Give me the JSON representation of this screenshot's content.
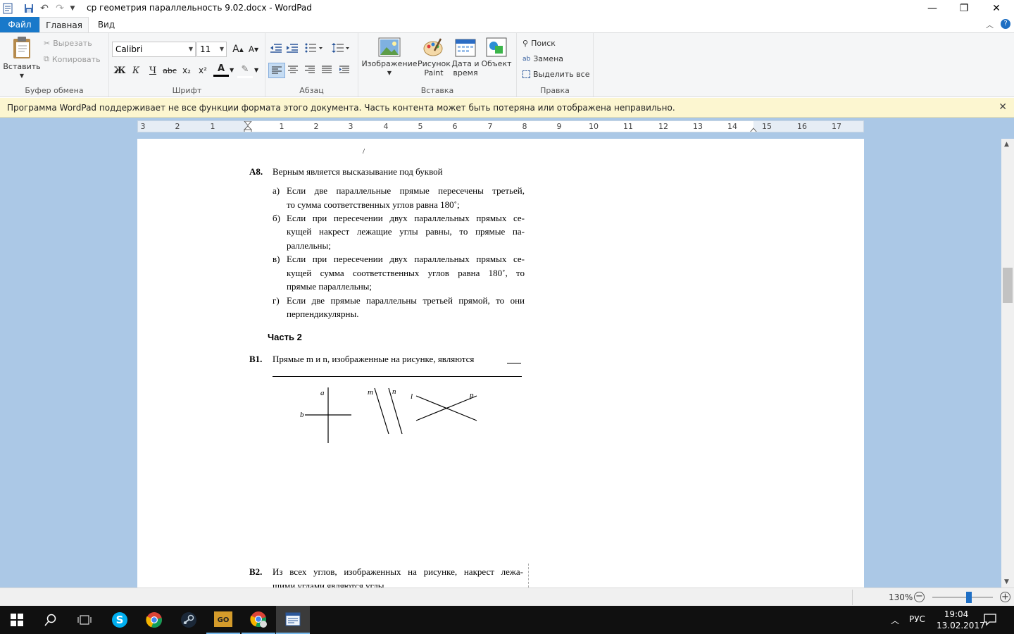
{
  "titlebar": {
    "title": "ср геометрия параллельность 9.02.docx - WordPad",
    "minimize": "—",
    "restore": "❐",
    "close": "✕"
  },
  "tabs": {
    "file": "Файл",
    "home": "Главная",
    "view": "Вид"
  },
  "ribbon": {
    "clipboard": {
      "label": "Буфер обмена",
      "paste": "Вставить",
      "cut": "Вырезать",
      "copy": "Копировать"
    },
    "font": {
      "label": "Шрифт",
      "family": "Calibri",
      "size": "11",
      "grow": "A",
      "shrink": "A",
      "bold": "Ж",
      "italic": "К",
      "underline": "Ч",
      "strike": "abc",
      "subscript": "x₂",
      "superscript": "x²",
      "color": "A",
      "highlight": "✎"
    },
    "paragraph": {
      "label": "Абзац"
    },
    "insert": {
      "label": "Вставка",
      "image": "Изображение",
      "paint_1": "Рисунок",
      "paint_2": "Paint",
      "datetime_1": "Дата и",
      "datetime_2": "время",
      "object": "Объект"
    },
    "edit": {
      "label": "Правка",
      "find": "Поиск",
      "replace": "Замена",
      "select_all": "Выделить все"
    }
  },
  "message": {
    "text": "Программа WordPad поддерживает не все функции формата этого документа. Часть контента может быть потеряна или отображена неправильно.",
    "close": "✕"
  },
  "ruler": {
    "left": [
      "3",
      "2",
      "1"
    ],
    "right": [
      "1",
      "2",
      "3",
      "4",
      "5",
      "6",
      "7",
      "8",
      "9",
      "10",
      "11",
      "12",
      "13",
      "14",
      "15",
      "16",
      "17"
    ]
  },
  "document": {
    "stray": "/",
    "a8": {
      "num": "А8.",
      "stem": "Верным является высказывание под буквой",
      "opt_a_mark": "а)",
      "opt_a_1": "Если две параллельные прямые пересечены третьей,",
      "opt_a_2": "то сумма соответственных углов равна 180˚;",
      "opt_b_mark": "б)",
      "opt_b_1": "Если при пересечении двух параллельных прямых се-",
      "opt_b_2": "кущей накрест лежащие углы равны, то прямые па-",
      "opt_b_3": "раллельны;",
      "opt_v_mark": "в)",
      "opt_v_1": "Если при пересечении двух параллельных прямых се-",
      "opt_v_2": "кущей сумма соответственных углов равна 180˚, то",
      "opt_v_3": "прямые параллельны;",
      "opt_g_mark": "г)",
      "opt_g_1": "Если две прямые параллельны третьей прямой, то они",
      "opt_g_2": "перпендикулярны."
    },
    "part2": "Часть 2",
    "b1": {
      "num": "В1.",
      "text": "Прямые m и n, изображенные на рисунке, являются",
      "fig_labels": {
        "a": "a",
        "b": "b",
        "m": "m",
        "n": "n",
        "l": "l",
        "p": "p"
      }
    },
    "b2": {
      "num": "В2.",
      "text_1": "Из всех углов, изображенных на рисунке, накрест лежа-",
      "text_2": "щими углами являются углы"
    }
  },
  "status": {
    "zoom": "130%",
    "zoom_level": 0.6
  },
  "taskbar": {
    "lang": "РУС",
    "time": "19:04",
    "date": "13.02.2017"
  }
}
